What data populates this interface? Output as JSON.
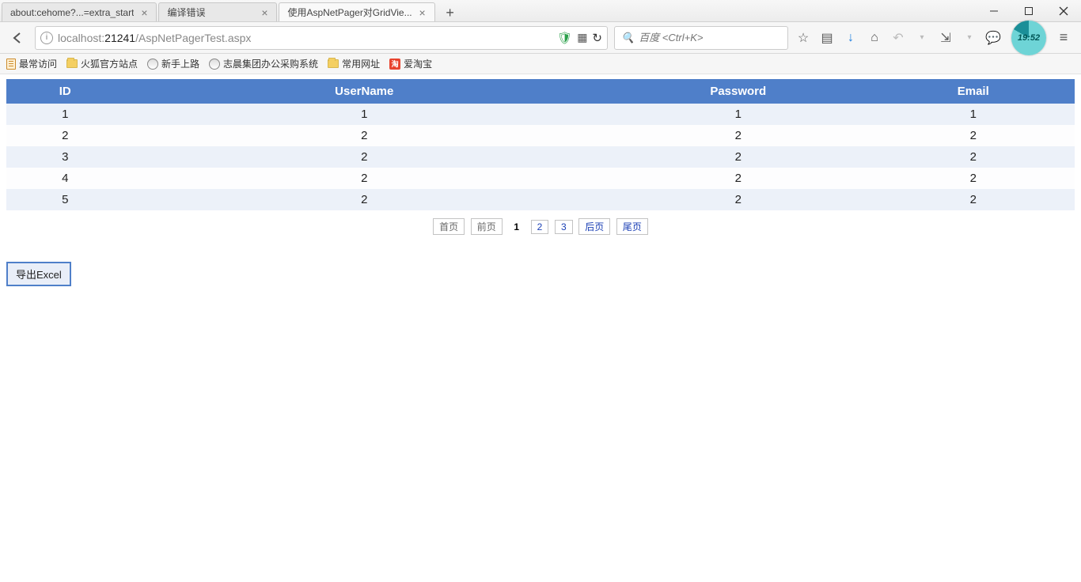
{
  "browser": {
    "tabs": [
      {
        "title": "about:cehome?...=extra_start",
        "active": false
      },
      {
        "title": "编译错误",
        "active": false
      },
      {
        "title": "使用AspNetPager对GridVie...",
        "active": true
      }
    ],
    "url_prefix": "localhost:",
    "url_mid": "21241",
    "url_rest": "/AspNetPagerTest.aspx",
    "search_placeholder": "百度 <Ctrl+K>",
    "clock_time": "19:52"
  },
  "bookmarks": {
    "b1": "最常访问",
    "b2": "火狐官方站点",
    "b3": "新手上路",
    "b4": "志晨集团办公采购系统",
    "b5": "常用网址",
    "b6_icon": "淘",
    "b6": "爱淘宝"
  },
  "grid": {
    "headers": {
      "c1": "ID",
      "c2": "UserName",
      "c3": "Password",
      "c4": "Email"
    },
    "rows": [
      {
        "id": "1",
        "user": "1",
        "pass": "1",
        "email": "1"
      },
      {
        "id": "2",
        "user": "2",
        "pass": "2",
        "email": "2"
      },
      {
        "id": "3",
        "user": "2",
        "pass": "2",
        "email": "2"
      },
      {
        "id": "4",
        "user": "2",
        "pass": "2",
        "email": "2"
      },
      {
        "id": "5",
        "user": "2",
        "pass": "2",
        "email": "2"
      }
    ]
  },
  "pager": {
    "first": "首页",
    "prev": "前页",
    "p1": "1",
    "p2": "2",
    "p3": "3",
    "next": "后页",
    "last": "尾页"
  },
  "buttons": {
    "export": "导出Excel"
  }
}
